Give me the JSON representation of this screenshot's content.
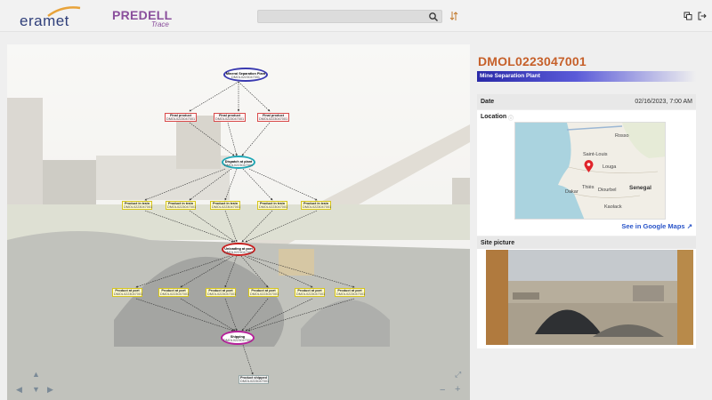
{
  "header": {
    "brand": "eramet",
    "app_name": "PREDELL",
    "app_sub": "Trace",
    "search_placeholder": "",
    "icons": [
      "search-icon",
      "swap-icon",
      "copy-icon",
      "logout-icon"
    ]
  },
  "diagram": {
    "nodes": {
      "mineral_plant": {
        "title": "Mineral Separation Plant",
        "id": "DMOL0223047001"
      },
      "final1": {
        "title": "Final product",
        "id": "DMOL0223047001"
      },
      "final2": {
        "title": "Final product",
        "id": "DMOL0223047001"
      },
      "final3": {
        "title": "Final product",
        "id": "DMOL0223047001"
      },
      "dispatch": {
        "title": "Dispatch at plant",
        "id": "DMOL0223047001"
      },
      "train1": {
        "title": "Product in train",
        "id": "DMOL0223047001"
      },
      "train2": {
        "title": "Product in train",
        "id": "DMOL0223047001"
      },
      "train3": {
        "title": "Product in train",
        "id": "DMOL0223047001"
      },
      "train4": {
        "title": "Product in train",
        "id": "DMOL0223047001"
      },
      "train5": {
        "title": "Product in train",
        "id": "DMOL0223047001"
      },
      "unloading": {
        "title": "Unloading at port",
        "id": "DMOL0223047001"
      },
      "port1": {
        "title": "Product at port",
        "id": "DMOL0223047001"
      },
      "port2": {
        "title": "Product at port",
        "id": "DMOL0223047001"
      },
      "port3": {
        "title": "Product at port",
        "id": "DMOL0223047001"
      },
      "port4": {
        "title": "Product at port",
        "id": "DMOL0223047001"
      },
      "port5": {
        "title": "Product at port",
        "id": "DMOL0223047001"
      },
      "port6": {
        "title": "Product at port",
        "id": "DMOL0223047001"
      },
      "shipping": {
        "title": "Shipping",
        "id": "DMOL0223047001"
      },
      "shipped": {
        "title": "Product shipped",
        "id": "DMOL0223047001"
      }
    },
    "nav": {
      "up": "▲",
      "down": "▼",
      "left": "◀",
      "right": "▶",
      "zoom_out": "−",
      "zoom_in": "+",
      "fit": "⤢"
    }
  },
  "details": {
    "title": "DMOL0223047001",
    "site_name": "Mine Separation Plant",
    "date_label": "Date",
    "date_value": "02/16/2023, 7:00 AM",
    "location_label": "Location",
    "location_info": "ⓘ",
    "map_labels": {
      "rosso": "Rosso",
      "saint_louis": "Saint-Louis",
      "louga": "Louga",
      "senegal": "Senegal",
      "dakar": "Dakar",
      "thies": "Thiès",
      "diourbel": "Diourbel",
      "kaolack": "Kaolack"
    },
    "google_maps_link": "See in Google Maps",
    "site_picture_label": "Site picture"
  },
  "colors": {
    "accent_title": "#c6602a",
    "band": "#2a2aa8",
    "link": "#2a55c9"
  }
}
